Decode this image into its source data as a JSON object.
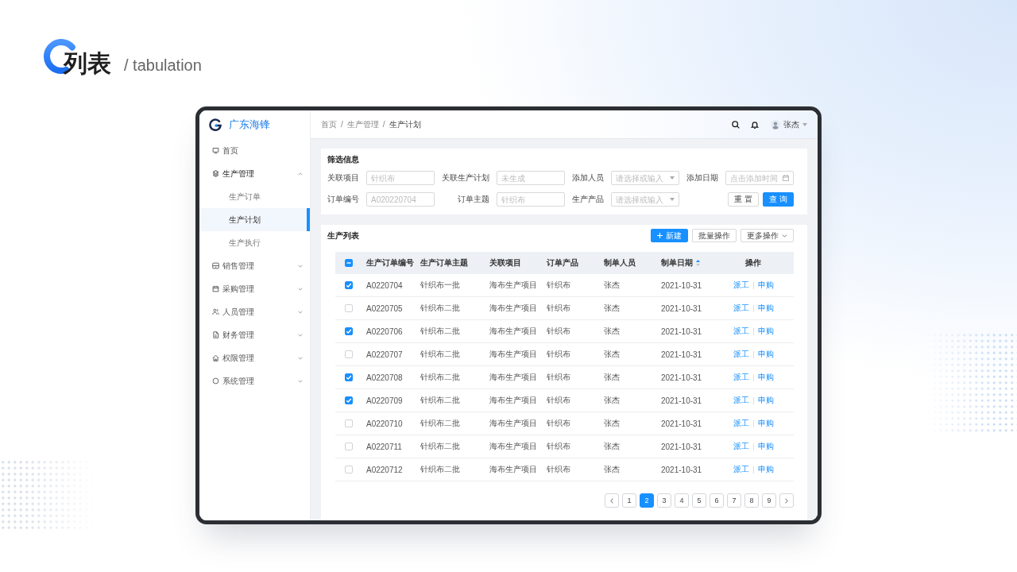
{
  "heading": {
    "title": "列表",
    "subtitle": "/ tabulation"
  },
  "sidebar": {
    "brand": "广东海锋",
    "items": [
      {
        "label": "首页",
        "selected": false
      },
      {
        "label": "生产管理",
        "selected": false,
        "expanded": true,
        "children": [
          {
            "label": "生产订单",
            "selected": false
          },
          {
            "label": "生产计划",
            "selected": true
          },
          {
            "label": "生产执行",
            "selected": false
          }
        ]
      },
      {
        "label": "销售管理",
        "selected": false,
        "expanded": false
      },
      {
        "label": "采购管理",
        "selected": false,
        "expanded": false
      },
      {
        "label": "人员管理",
        "selected": false,
        "expanded": false
      },
      {
        "label": "财务管理",
        "selected": false,
        "expanded": false
      },
      {
        "label": "权限管理",
        "selected": false,
        "expanded": false
      },
      {
        "label": "系统管理",
        "selected": false,
        "expanded": false
      }
    ]
  },
  "header": {
    "breadcrumb": {
      "separator": "/",
      "items": [
        "首页",
        "生产管理",
        "生产计划"
      ]
    },
    "user": {
      "name": "张杰"
    }
  },
  "filter": {
    "title": "筛选信息",
    "fields": [
      {
        "label": "关联项目",
        "kind": "text",
        "placeholder": "针织布"
      },
      {
        "label": "关联生产计划",
        "kind": "text",
        "placeholder": "未生成"
      },
      {
        "label": "添加人员",
        "kind": "select",
        "placeholder": "请选择或输入"
      },
      {
        "label": "添加日期",
        "kind": "date",
        "placeholder": "点击添加时间"
      },
      {
        "label": "订单编号",
        "kind": "text",
        "placeholder": "A020220704"
      },
      {
        "label": "订单主题",
        "kind": "text",
        "placeholder": "针织布"
      },
      {
        "label": "生产产品",
        "kind": "select",
        "placeholder": "请选择或输入"
      }
    ],
    "buttons": [
      {
        "label": "重 置",
        "kind": "default"
      },
      {
        "label": "查 询",
        "kind": "primary"
      }
    ]
  },
  "list": {
    "title": "生产列表",
    "buttons": [
      {
        "label": "新建",
        "kind": "primary"
      },
      {
        "label": "批量操作",
        "kind": "default"
      },
      {
        "label": "更多操作",
        "kind": "dropdown"
      }
    ]
  },
  "table": {
    "select_all": {
      "indeterminate": true
    },
    "columns": [
      {
        "label": "生产订单编号"
      },
      {
        "label": "生产订单主题"
      },
      {
        "label": "关联项目"
      },
      {
        "label": "订单产品"
      },
      {
        "label": "制单人员"
      },
      {
        "label": "制单日期",
        "sorted": true
      },
      {
        "label": "操作"
      }
    ],
    "rows": [
      {
        "checked": true,
        "cells": [
          "A0220704",
          "针织布一批",
          "海布生产项目",
          "针织布",
          "张杰",
          "2021-10-31"
        ],
        "actions": [
          "派工",
          "申购"
        ]
      },
      {
        "checked": false,
        "cells": [
          "A0220705",
          "针织布二批",
          "海布生产项目",
          "针织布",
          "张杰",
          "2021-10-31"
        ],
        "actions": [
          "派工",
          "申购"
        ]
      },
      {
        "checked": true,
        "cells": [
          "A0220706",
          "针织布二批",
          "海布生产项目",
          "针织布",
          "张杰",
          "2021-10-31"
        ],
        "actions": [
          "派工",
          "申购"
        ]
      },
      {
        "checked": false,
        "cells": [
          "A0220707",
          "针织布二批",
          "海布生产项目",
          "针织布",
          "张杰",
          "2021-10-31"
        ],
        "actions": [
          "派工",
          "申购"
        ]
      },
      {
        "checked": true,
        "cells": [
          "A0220708",
          "针织布二批",
          "海布生产项目",
          "针织布",
          "张杰",
          "2021-10-31"
        ],
        "actions": [
          "派工",
          "申购"
        ]
      },
      {
        "checked": true,
        "cells": [
          "A0220709",
          "针织布二批",
          "海布生产项目",
          "针织布",
          "张杰",
          "2021-10-31"
        ],
        "actions": [
          "派工",
          "申购"
        ]
      },
      {
        "checked": false,
        "cells": [
          "A0220710",
          "针织布二批",
          "海布生产项目",
          "针织布",
          "张杰",
          "2021-10-31"
        ],
        "actions": [
          "派工",
          "申购"
        ]
      },
      {
        "checked": false,
        "cells": [
          "A0220711",
          "针织布二批",
          "海布生产项目",
          "针织布",
          "张杰",
          "2021-10-31"
        ],
        "actions": [
          "派工",
          "申购"
        ]
      },
      {
        "checked": false,
        "cells": [
          "A0220712",
          "针织布二批",
          "海布生产项目",
          "针织布",
          "张杰",
          "2021-10-31"
        ],
        "actions": [
          "派工",
          "申购"
        ]
      }
    ]
  },
  "pagination": {
    "pages": [
      {
        "label": "1",
        "selected": false
      },
      {
        "label": "2",
        "selected": true
      },
      {
        "label": "3",
        "selected": false
      },
      {
        "label": "4",
        "selected": false
      },
      {
        "label": "5",
        "selected": false
      },
      {
        "label": "6",
        "selected": false
      },
      {
        "label": "7",
        "selected": false
      },
      {
        "label": "8",
        "selected": false
      },
      {
        "label": "9",
        "selected": false
      }
    ]
  }
}
